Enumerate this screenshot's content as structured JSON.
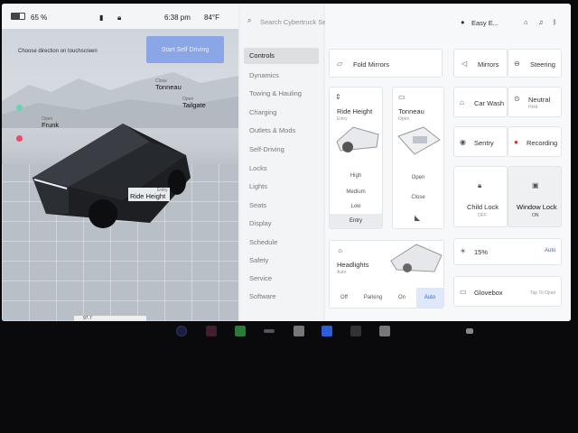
{
  "status": {
    "battery": "65 %",
    "time": "6:38 pm",
    "temp": "84°F"
  },
  "scene": {
    "hint": "Choose direction on touchscreen",
    "start_button": "Start Self Driving",
    "labels": {
      "frunk_sub": "Open",
      "frunk": "Frunk",
      "tonneau_sub": "Close",
      "tonneau": "Tonneau",
      "tailgate_sub": "Open",
      "tailgate": "Tailgate",
      "ride_sub": "Entry",
      "ride": "Ride Height"
    },
    "odometer": "97.7"
  },
  "search": {
    "placeholder": "Search Cybertruck Settings"
  },
  "menu": [
    "Controls",
    "Dynamics",
    "Towing & Hauling",
    "Charging",
    "Outlets & Mods",
    "Self-Driving",
    "Locks",
    "Lights",
    "Seats",
    "Display",
    "Schedule",
    "Safety",
    "Service",
    "Software"
  ],
  "profile": "Easy E...",
  "controls": {
    "fold_mirrors": "Fold Mirrors",
    "mirrors": "Mirrors",
    "steering": "Steering",
    "ride_height": {
      "title": "Ride Height",
      "sub": "Entry",
      "options": [
        "High",
        "Medium",
        "Low",
        "Entry"
      ]
    },
    "tonneau": {
      "title": "Tonneau",
      "sub": "Open",
      "options": [
        "Open",
        "Close"
      ]
    },
    "car_wash": "Car Wash",
    "neutral": "Neutral",
    "neutral_sub": "Hold",
    "sentry": "Sentry",
    "recording": "Recording",
    "child_lock": "Child Lock",
    "child_lock_sub": "OFF",
    "window_lock": "Window Lock",
    "window_lock_sub": "ON",
    "headlights": {
      "title": "Headlights",
      "sub": "Auto",
      "options": [
        "Off",
        "Parking",
        "On",
        "Auto"
      ]
    },
    "brightness": "15%",
    "brightness_mode": "Auto",
    "glovebox": "Glovebox",
    "glovebox_hint": "Tap To Open"
  },
  "colors": {
    "accent": "#3d63d8",
    "start_button": "#8aa6e6"
  }
}
